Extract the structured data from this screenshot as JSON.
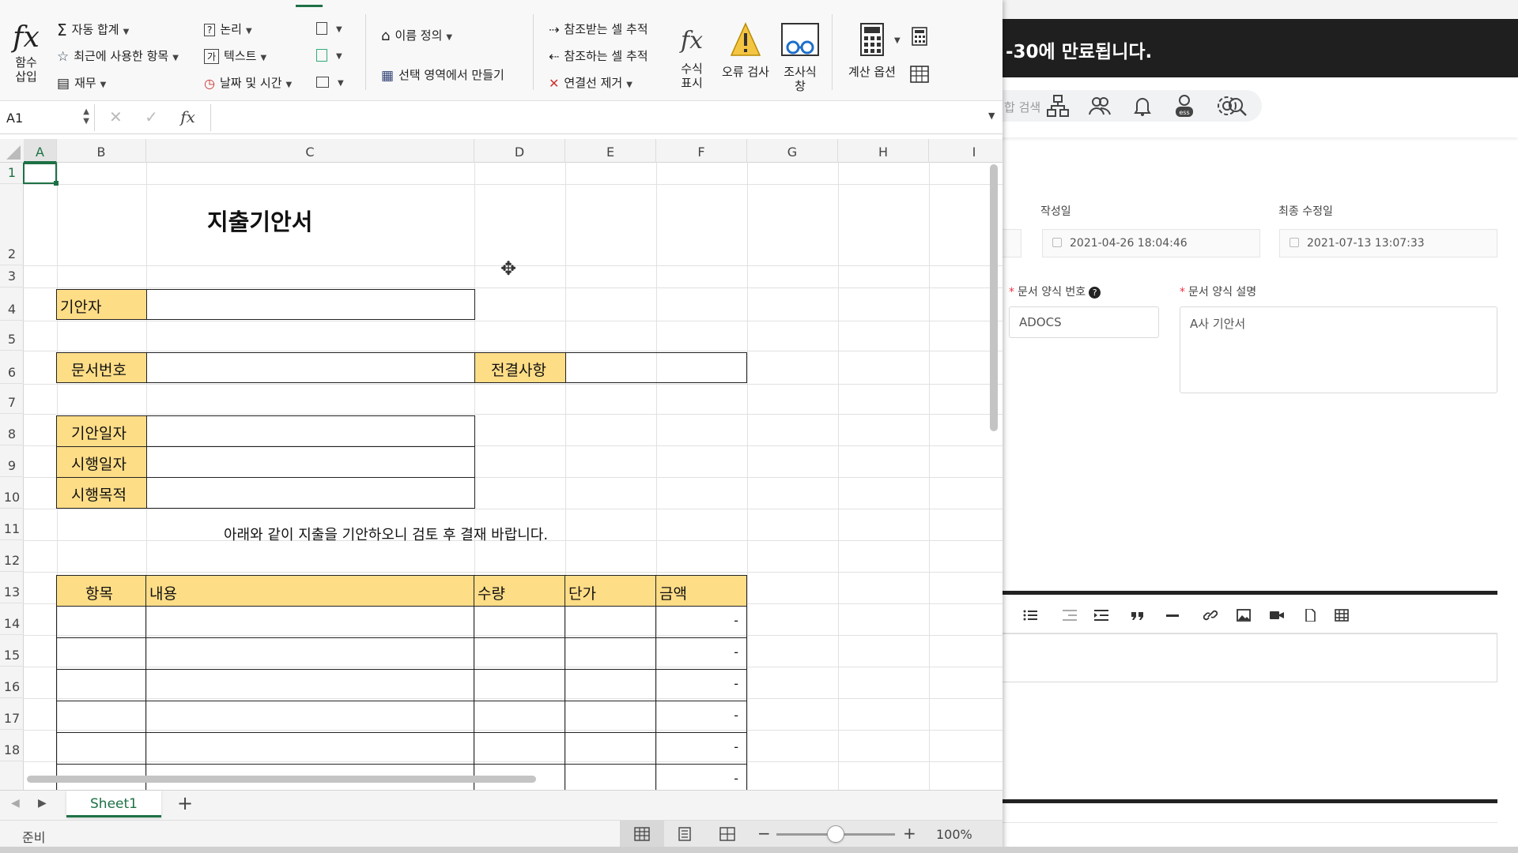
{
  "bg_app": {
    "banner_text": "-30에 만료됩니다.",
    "search_placeholder": "합 검색",
    "created_label": "작성일",
    "created_value": "2021-04-26 18:04:46",
    "modified_label": "최종 수정일",
    "modified_value": "2021-07-13 13:07:33",
    "form_no_label": "문서 양식 번호",
    "form_no_help": "?",
    "form_no_value": "ADOCS",
    "form_desc_label": "문서 양식 설명",
    "form_desc_value": "A사 기안서"
  },
  "ribbon": {
    "insert_function": "함수\n삽입",
    "autosum": "자동 합계",
    "recent": "최근에 사용한 항목",
    "financial": "재무",
    "logical": "논리",
    "text": "텍스트",
    "datetime": "날짜 및 시간",
    "define_name": "이름 정의",
    "create_from_selection": "선택 영역에서 만들기",
    "trace_precedents": "참조받는 셀 추적",
    "trace_dependents": "참조하는 셀 추적",
    "remove_arrows": "연결선 제거",
    "show_formulas": "수식\n표시",
    "error_check": "오류 검사",
    "watch_window": "조사식\n창",
    "calc_options": "계산 옵션"
  },
  "formula_bar": {
    "name_box": "A1",
    "fx": "fx"
  },
  "columns": [
    "A",
    "B",
    "C",
    "D",
    "E",
    "F",
    "G",
    "H",
    "I"
  ],
  "rows": [
    "1",
    "2",
    "3",
    "4",
    "5",
    "6",
    "7",
    "8",
    "9",
    "10",
    "11",
    "12",
    "13",
    "14",
    "15",
    "16",
    "17",
    "18"
  ],
  "sheet": {
    "title": "지출기안서",
    "drafter": "기안자",
    "doc_no": "문서번호",
    "decision": "전결사항",
    "draft_date": "기안일자",
    "exec_date": "시행일자",
    "purpose": "시행목적",
    "notice": "아래와 같이 지출을 기안하오니 검토 후 결재 바랍니다.",
    "table_headers": [
      "항목",
      "내용",
      "수량",
      "단가",
      "금액"
    ],
    "amounts": [
      "-",
      "-",
      "-",
      "-",
      "-",
      "-"
    ]
  },
  "sheet_tab": "Sheet1",
  "add_sheet": "+",
  "status": {
    "ready": "준비",
    "zoom": "100%"
  }
}
